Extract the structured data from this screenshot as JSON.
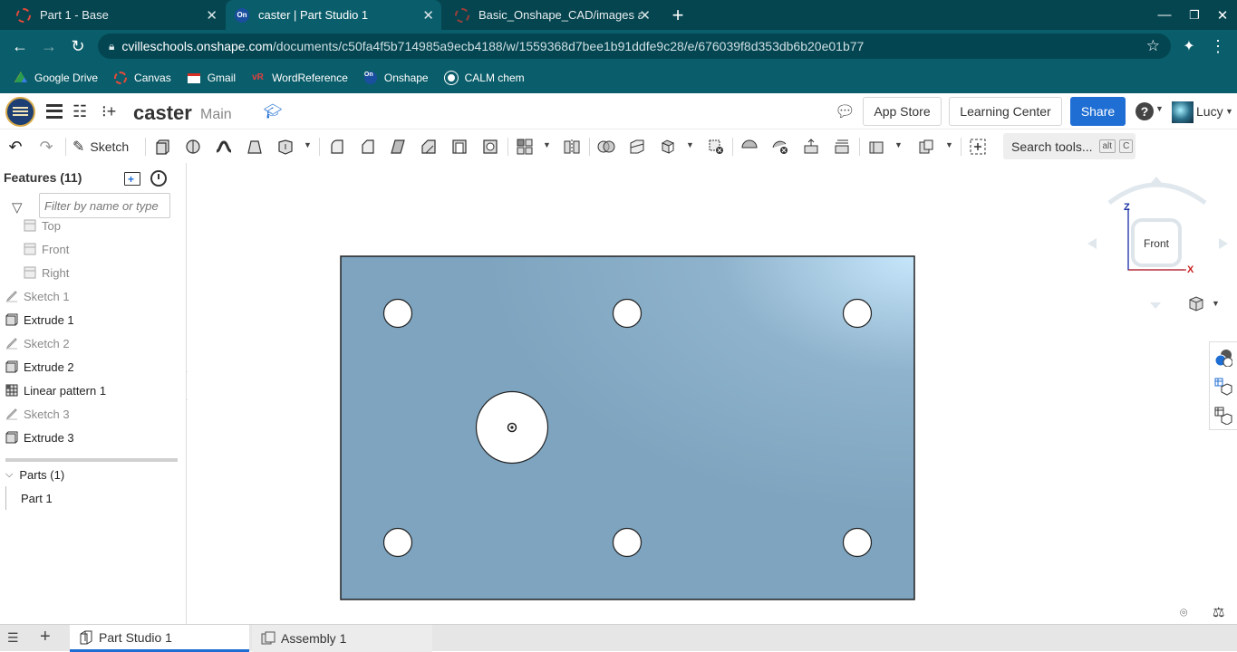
{
  "browser": {
    "tabs": [
      {
        "title": "Part 1 - Base",
        "icon": "canvas-ring-icon"
      },
      {
        "title": "caster | Part Studio 1",
        "icon": "onshape-icon"
      },
      {
        "title": "Basic_Onshape_CAD/images at",
        "icon": "github-ring-icon"
      }
    ],
    "url_host": "cvilleschools.onshape.com",
    "url_path": "/documents/c50fa4f5b714985a9ecb4188/w/1559368d7bee1b91ddfe9c28/e/676039f8d353db6b20e01b77",
    "bookmarks": [
      {
        "label": "Google Drive",
        "icon": "google-drive-icon"
      },
      {
        "label": "Canvas",
        "icon": "canvas-icon"
      },
      {
        "label": "Gmail",
        "icon": "gmail-icon"
      },
      {
        "label": "WordReference",
        "icon": "wordreference-icon"
      },
      {
        "label": "Onshape",
        "icon": "onshape-icon"
      },
      {
        "label": "CALM chem",
        "icon": "globe-icon"
      }
    ]
  },
  "header": {
    "doc_title": "caster",
    "branch": "Main",
    "app_store": "App Store",
    "learning_center": "Learning Center",
    "share": "Share",
    "user": "Lucy"
  },
  "toolbar": {
    "sketch_label": "Sketch",
    "search_tools": "Search tools...",
    "search_key1": "alt",
    "search_key2": "C"
  },
  "features": {
    "title": "Features (11)",
    "filter_placeholder": "Filter by name or type",
    "items": [
      {
        "label": "Top",
        "kind": "plane"
      },
      {
        "label": "Front",
        "kind": "plane"
      },
      {
        "label": "Right",
        "kind": "plane"
      },
      {
        "label": "Sketch 1",
        "kind": "sketch"
      },
      {
        "label": "Extrude 1",
        "kind": "extrude"
      },
      {
        "label": "Sketch 2",
        "kind": "sketch"
      },
      {
        "label": "Extrude 2",
        "kind": "extrude"
      },
      {
        "label": "Linear pattern 1",
        "kind": "pattern"
      },
      {
        "label": "Sketch 3",
        "kind": "sketch"
      },
      {
        "label": "Extrude 3",
        "kind": "extrude"
      }
    ],
    "parts_title": "Parts (1)",
    "parts": [
      "Part 1"
    ]
  },
  "viewcube": {
    "face": "Front",
    "axis_z": "Z",
    "axis_x": "X"
  },
  "bottom_tabs": [
    "Part Studio 1",
    "Assembly 1"
  ],
  "colors": {
    "tab_strip": "#05454f",
    "toolbar_teal": "#0a5d6a",
    "share_blue": "#1f6ed4",
    "part_face": "#7ea4bf",
    "part_face_highlight": "#c6e6fb"
  }
}
